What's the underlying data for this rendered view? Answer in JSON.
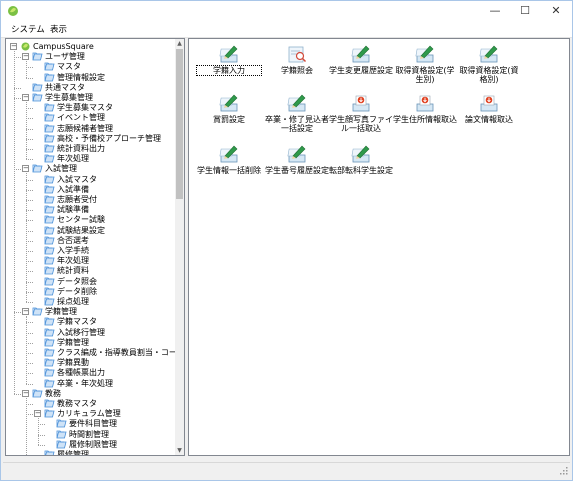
{
  "window": {
    "minimize": "—",
    "maximize": "☐",
    "close": "✕"
  },
  "menu": [
    {
      "label": "システム"
    },
    {
      "label": "表示"
    }
  ],
  "tree": [
    {
      "label": "CampusSquare",
      "level": 0,
      "expander": "−",
      "icon": "app"
    },
    {
      "label": "ユーザ管理",
      "level": 1,
      "expander": "−",
      "icon": "folder"
    },
    {
      "label": "マスタ",
      "level": 2,
      "icon": "folder"
    },
    {
      "label": "管理情報設定",
      "level": 2,
      "icon": "folder"
    },
    {
      "label": "共通マスタ",
      "level": 1,
      "icon": "folder"
    },
    {
      "label": "学生募集管理",
      "level": 1,
      "expander": "−",
      "icon": "folder"
    },
    {
      "label": "学生募集マスタ",
      "level": 2,
      "icon": "folder"
    },
    {
      "label": "イベント管理",
      "level": 2,
      "icon": "folder"
    },
    {
      "label": "志願候補者管理",
      "level": 2,
      "icon": "folder"
    },
    {
      "label": "高校・予備校アプローチ管理",
      "level": 2,
      "icon": "folder"
    },
    {
      "label": "統計資料出力",
      "level": 2,
      "icon": "folder"
    },
    {
      "label": "年次処理",
      "level": 2,
      "icon": "folder"
    },
    {
      "label": "入試管理",
      "level": 1,
      "expander": "−",
      "icon": "folder"
    },
    {
      "label": "入試マスタ",
      "level": 2,
      "icon": "folder"
    },
    {
      "label": "入試準備",
      "level": 2,
      "icon": "folder"
    },
    {
      "label": "志願者受付",
      "level": 2,
      "icon": "folder"
    },
    {
      "label": "試験準備",
      "level": 2,
      "icon": "folder"
    },
    {
      "label": "センター試験",
      "level": 2,
      "icon": "folder"
    },
    {
      "label": "試験結果設定",
      "level": 2,
      "icon": "folder"
    },
    {
      "label": "合否選考",
      "level": 2,
      "icon": "folder"
    },
    {
      "label": "入学手続",
      "level": 2,
      "icon": "folder"
    },
    {
      "label": "年次処理",
      "level": 2,
      "icon": "folder"
    },
    {
      "label": "統計資料",
      "level": 2,
      "icon": "folder"
    },
    {
      "label": "データ照会",
      "level": 2,
      "icon": "folder"
    },
    {
      "label": "データ削除",
      "level": 2,
      "icon": "folder"
    },
    {
      "label": "採点処理",
      "level": 2,
      "icon": "folder"
    },
    {
      "label": "学籍管理",
      "level": 1,
      "expander": "−",
      "icon": "folder"
    },
    {
      "label": "学籍マスタ",
      "level": 2,
      "icon": "folder"
    },
    {
      "label": "入試移行管理",
      "level": 2,
      "icon": "folder"
    },
    {
      "label": "学籍管理",
      "level": 2,
      "icon": "folder"
    },
    {
      "label": "クラス編成・指導教員割当・コース配属",
      "level": 2,
      "icon": "folder"
    },
    {
      "label": "学籍異動",
      "level": 2,
      "icon": "folder"
    },
    {
      "label": "各種帳票出力",
      "level": 2,
      "icon": "folder"
    },
    {
      "label": "卒業・年次処理",
      "level": 2,
      "icon": "folder"
    },
    {
      "label": "教務",
      "level": 1,
      "expander": "−",
      "icon": "folder"
    },
    {
      "label": "教務マスタ",
      "level": 2,
      "icon": "folder"
    },
    {
      "label": "カリキュラム管理",
      "level": 2,
      "expander": "−",
      "icon": "folder"
    },
    {
      "label": "要件科目管理",
      "level": 3,
      "icon": "folder"
    },
    {
      "label": "時間割管理",
      "level": 3,
      "icon": "folder"
    },
    {
      "label": "履修制限管理",
      "level": 3,
      "icon": "folder"
    },
    {
      "label": "履修管理",
      "level": 2,
      "icon": "folder"
    }
  ],
  "tiles": [
    {
      "label": "学籍入力",
      "icon": "pencil",
      "focused": true
    },
    {
      "label": "学籍照会",
      "icon": "search"
    },
    {
      "label": "学生変更履歴設定",
      "icon": "pencil"
    },
    {
      "label": "取得資格設定(学生別)",
      "icon": "pencil"
    },
    {
      "label": "取得資格設定(資格別)",
      "icon": "pencil"
    },
    {
      "label": "賞罰設定",
      "icon": "pencil"
    },
    {
      "label": "卒業・修了見込者一括設定",
      "icon": "pencil"
    },
    {
      "label": "学生顔写真ファイル一括取込",
      "icon": "import"
    },
    {
      "label": "学生住所情報取込",
      "icon": "import"
    },
    {
      "label": "論文情報取込",
      "icon": "import"
    },
    {
      "label": "学生情報一括削除",
      "icon": "pencil"
    },
    {
      "label": "学生番号履歴設定",
      "icon": "pencil"
    },
    {
      "label": "転部転科学生設定",
      "icon": "pencil"
    }
  ],
  "colors": {
    "folder": "#4a90d9",
    "folder_light": "#cfe3f7",
    "pencil": "#2f9a4b",
    "accent_red": "#e04020"
  }
}
